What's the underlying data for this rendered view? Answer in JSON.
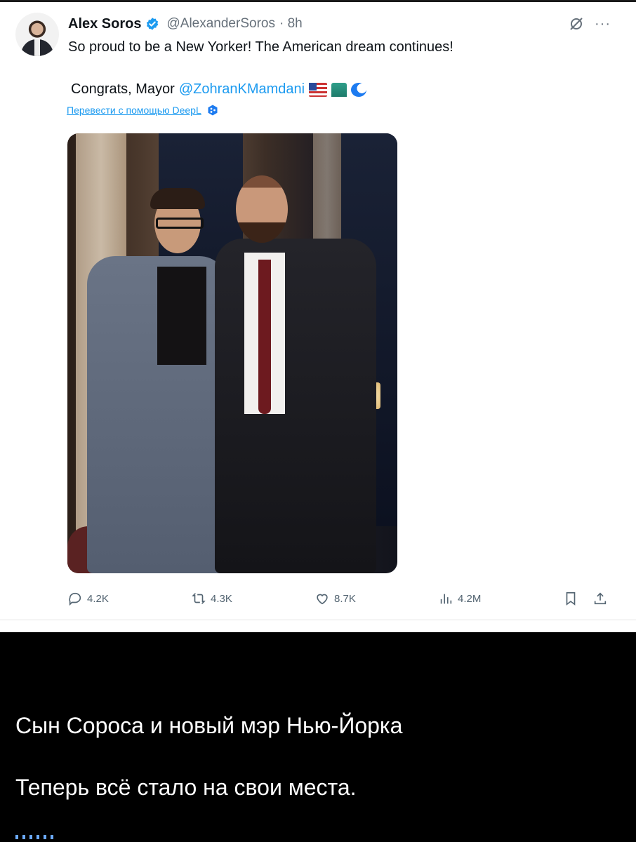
{
  "tweet": {
    "author_name": "Alex Soros",
    "handle": "@AlexanderSoros",
    "time": "· 8h",
    "text_line1": "So proud to be a New Yorker! The American dream continues!",
    "text_line2_prefix": "Congrats, Mayor",
    "mention": "@ZohranKMamdani",
    "translate_link": "Перевести с помощью DeepL",
    "stats": {
      "replies": "4.2K",
      "reposts": "4.3K",
      "likes": "8.7K",
      "views": "4.2M"
    }
  },
  "caption": {
    "line1": "Сын Сороса и новый мэр Нью-Йорка",
    "line2": "Теперь всё стало на свои места."
  },
  "colors": {
    "accent": "#1d9bf0",
    "text": "#0f1419",
    "muted": "#536471",
    "caption_bg": "#000000"
  }
}
